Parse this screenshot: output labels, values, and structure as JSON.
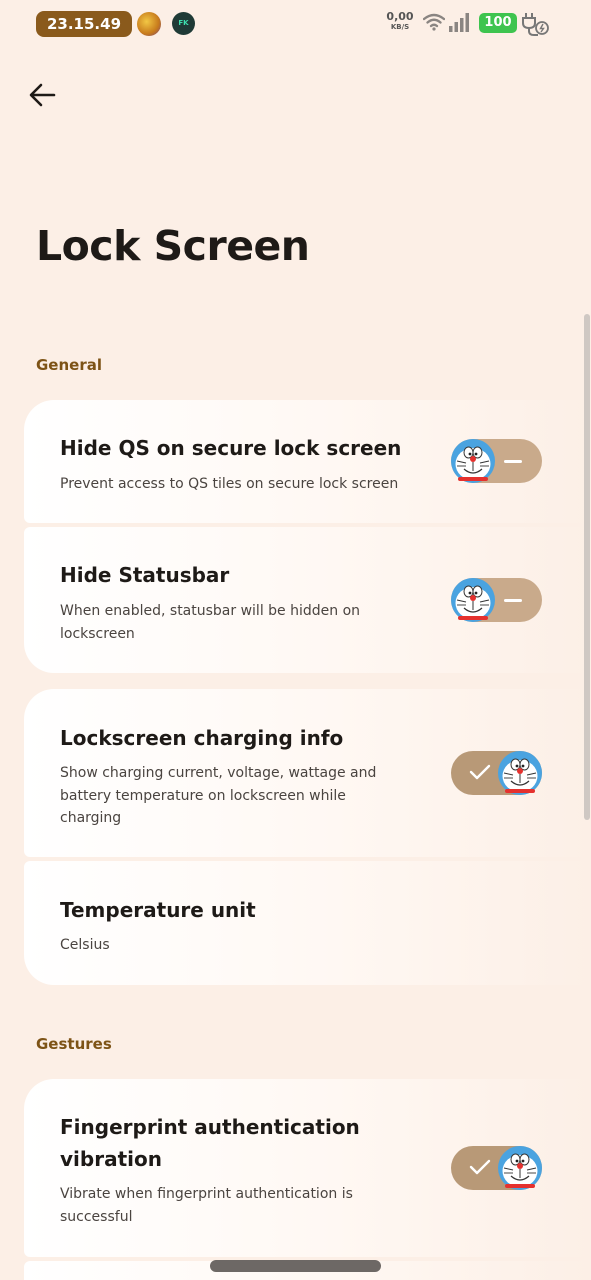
{
  "status_bar": {
    "time": "23.15.49",
    "app_badge": "FK",
    "net_speed_value": "0,00",
    "net_speed_unit": "KB/S",
    "battery": "100"
  },
  "page": {
    "title": "Lock Screen"
  },
  "sections": [
    {
      "header": "General",
      "items": [
        {
          "title": "Hide QS on secure lock screen",
          "subtitle": "Prevent access to QS tiles on secure lock screen",
          "toggle": false
        },
        {
          "title": "Hide Statusbar",
          "subtitle_lines": [
            "When enabled, statusbar will be hidden on",
            "lockscreen"
          ],
          "toggle": false
        },
        {
          "title": "Lockscreen charging info",
          "subtitle_lines": [
            "Show charging current, voltage, wattage and",
            "battery temperature on lockscreen while",
            "charging"
          ],
          "toggle": true
        },
        {
          "title": "Temperature unit",
          "subtitle": "Celsius"
        }
      ]
    },
    {
      "header": "Gestures",
      "items": [
        {
          "title_lines": [
            "Fingerprint authentication",
            "vibration"
          ],
          "subtitle_lines": [
            "Vibrate when fingerprint authentication is",
            "successful"
          ],
          "toggle": true
        }
      ]
    }
  ],
  "icons": {
    "back": "arrow-left-icon",
    "wifi": "wifi-icon",
    "signal": "cell-signal-icon",
    "charging": "charging-plug-icon",
    "toggle_knob": "doraemon-face-icon"
  },
  "colors": {
    "background": "#fcefe6",
    "accent_brown": "#7d5316",
    "time_pill": "#8a5a1c",
    "toggle_track": "#c9aa8b",
    "battery_green": "#3ec44f"
  }
}
